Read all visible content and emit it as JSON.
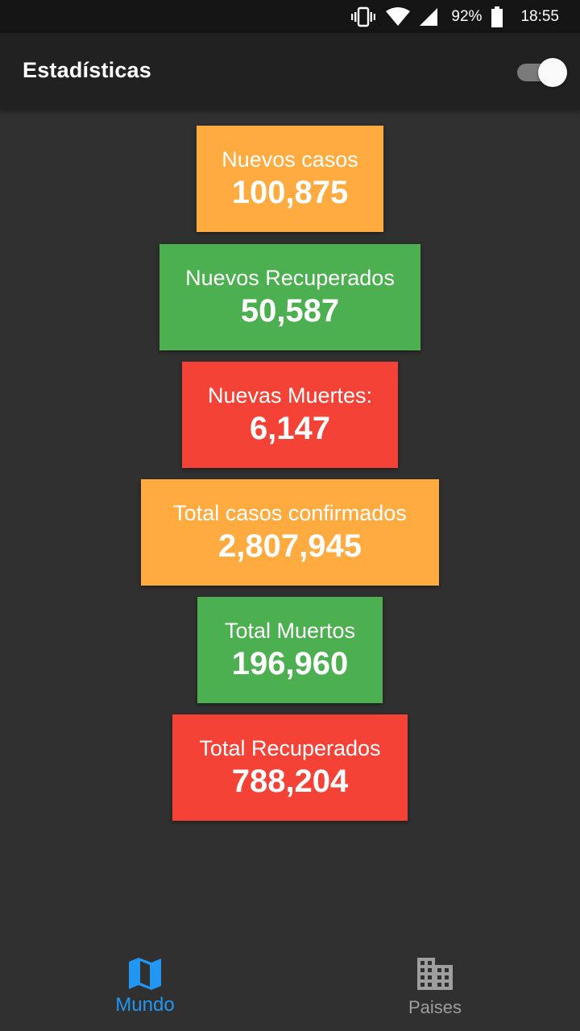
{
  "status_bar": {
    "icons": [
      "vibrate-icon",
      "wifi-icon",
      "signal-icon",
      "battery-icon"
    ],
    "battery": "92%",
    "time": "18:55"
  },
  "app_bar": {
    "title": "Estadísticas",
    "toggle_on": true
  },
  "cards": [
    {
      "label": "Nuevos casos",
      "value": "100,875",
      "color": "#ffab40"
    },
    {
      "label": "Nuevos Recuperados",
      "value": "50,587",
      "color": "#4caf50"
    },
    {
      "label": "Nuevas Muertes:",
      "value": "6,147",
      "color": "#f44336"
    },
    {
      "label": "Total casos confirmados",
      "value": "2,807,945",
      "color": "#ffab40"
    },
    {
      "label": "Total Muertos",
      "value": "196,960",
      "color": "#4caf50"
    },
    {
      "label": "Total Recuperados",
      "value": "788,204",
      "color": "#f44336"
    }
  ],
  "bottom_nav": {
    "items": [
      {
        "label": "Mundo",
        "icon": "map-icon",
        "active": true
      },
      {
        "label": "Paises",
        "icon": "city-icon",
        "active": false
      }
    ]
  },
  "colors": {
    "active": "#2196f3",
    "inactive": "#9e9e9e",
    "background": "#303030",
    "app_bar": "#212121"
  }
}
